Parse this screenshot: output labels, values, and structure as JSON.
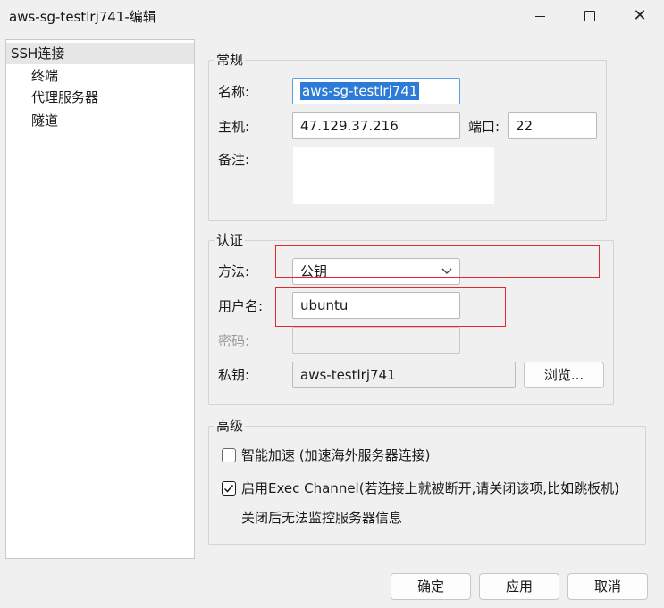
{
  "window": {
    "title": "aws-sg-testlrj741-编辑",
    "controls": {
      "minimize": "minimize",
      "maximize": "maximize",
      "close": "✕"
    }
  },
  "sidebar": {
    "items": [
      {
        "label": "SSH连接",
        "selected": true
      },
      {
        "label": "终端"
      },
      {
        "label": "代理服务器"
      },
      {
        "label": "隧道"
      }
    ]
  },
  "general": {
    "title": "常规",
    "name_label": "名称:",
    "name_value": "aws-sg-testlrj741",
    "host_label": "主机:",
    "host_value": "47.129.37.216",
    "port_label": "端口:",
    "port_value": "22",
    "note_label": "备注:",
    "note_value": ""
  },
  "auth": {
    "title": "认证",
    "method_label": "方法:",
    "method_value": "公钥",
    "username_label": "用户名:",
    "username_value": "ubuntu",
    "password_label": "密码:",
    "password_value": "",
    "key_label": "私钥:",
    "key_value": "aws-testlrj741",
    "browse_label": "浏览..."
  },
  "advanced": {
    "title": "高级",
    "smart_accel_label": "智能加速 (加速海外服务器连接)",
    "smart_accel_checked": false,
    "exec_channel_label": "启用Exec Channel(若连接上就被断开,请关闭该项,比如跳板机)",
    "exec_channel_checked": true,
    "exec_channel_note": "关闭后无法监控服务器信息"
  },
  "footer": {
    "ok_label": "确定",
    "apply_label": "应用",
    "cancel_label": "取消"
  },
  "colors": {
    "highlight": "#e0282e",
    "selection": "#2c7bd6"
  }
}
